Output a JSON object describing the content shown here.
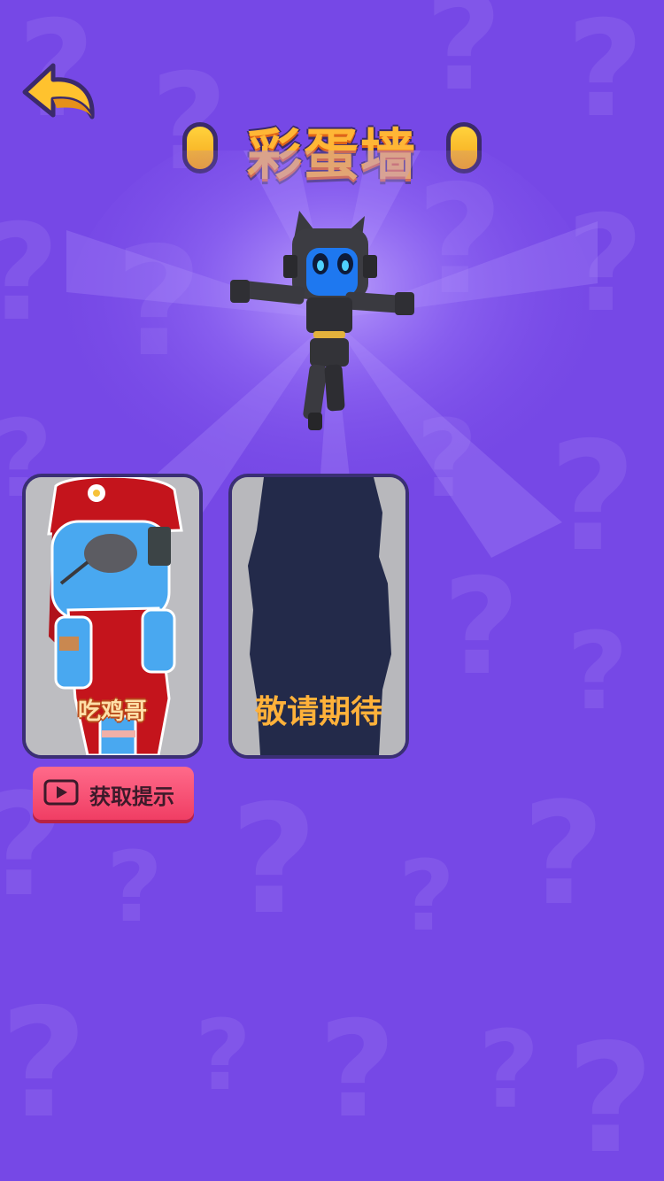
{
  "screen": {
    "title": "彩蛋墙",
    "background_color": "#7648e6",
    "accent_color": "#ffb636"
  },
  "back_button": {
    "icon": "return-arrow-icon"
  },
  "cards": [
    {
      "label": "吃鸡哥",
      "state": "unlocked"
    },
    {
      "label": "敬请期待",
      "state": "locked-silhouette"
    }
  ],
  "hint_button": {
    "label": "获取提示",
    "icon": "video-play-icon"
  }
}
